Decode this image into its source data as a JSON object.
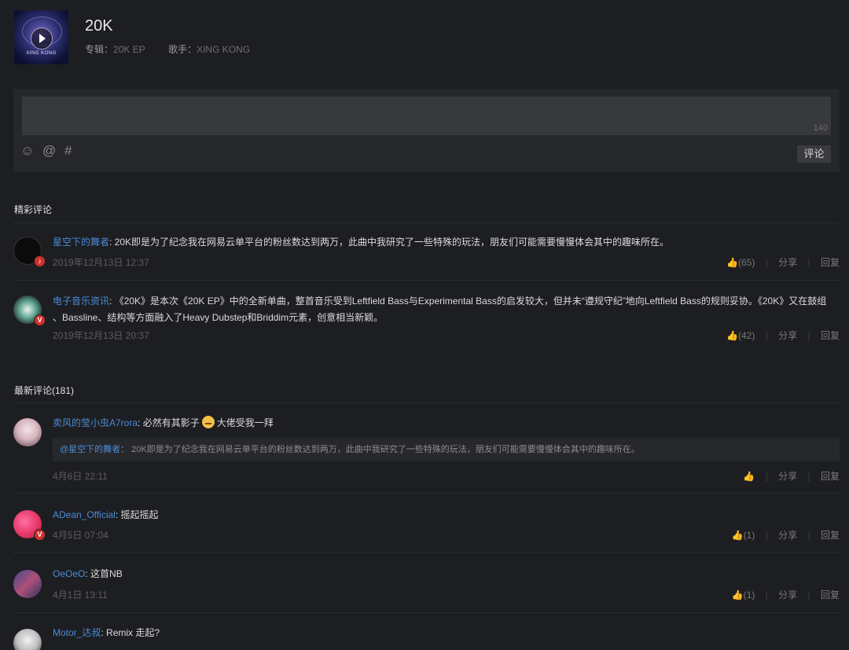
{
  "song": {
    "title": "20K",
    "cover_text": "XING KONG",
    "album_label": "专辑：",
    "album": "20K EP",
    "artist_label": "歌手：",
    "artist": "XING KONG"
  },
  "comment_box": {
    "placeholder": "",
    "char_count": "140",
    "submit_label": "评论",
    "icons": [
      "emoji-icon",
      "at-icon",
      "hashtag-icon"
    ]
  },
  "hot_section": {
    "title": "精彩评论"
  },
  "hot_comments": [
    {
      "user": "星空下的舞者",
      "text": "20K即是为了纪念我在网易云单平台的粉丝数达到两万，此曲中我研究了一些特殊的玩法，朋友们可能需要慢慢体会其中的趣味所在。",
      "time": "2019年12月13日 12:37",
      "likes": "(65)",
      "share": "分享",
      "reply": "回复"
    },
    {
      "user": "电子音乐资讯",
      "text_line1": "《20K》是本次《20K EP》中的全新单曲，整首音乐受到Leftfield Bass与Experimental Bass的启发较大，但并未“遵规守纪”地向Leftfield Bass的规则妥协。《20K》又在鼓组",
      "text_line2": "、Bassline、结构等方面融入了Heavy Dubstep和Briddim元素，创意相当新颖。",
      "time": "2019年12月13日 20:37",
      "likes": "(42)",
      "share": "分享",
      "reply": "回复"
    }
  ],
  "latest_section": {
    "title": "最新评论(181)"
  },
  "latest_comments": [
    {
      "user": "卖风的莹小虫A7rora",
      "text_before": "必然有其影子",
      "text_after": "大佬受我一拜",
      "quote_user": "@星空下的舞者",
      "quote_text": "20K即是为了纪念我在网易云单平台的粉丝数达到两万，此曲中我研究了一些特殊的玩法，朋友们可能需要慢慢体会其中的趣味所在。",
      "time": "4月6日 22:11",
      "likes": "",
      "share": "分享",
      "reply": "回复"
    },
    {
      "user": "ADean_Official",
      "text": "摇起摇起",
      "time": "4月5日 07:04",
      "likes": "(1)",
      "share": "分享",
      "reply": "回复"
    },
    {
      "user": "OeOeO",
      "text": "这首NB",
      "time": "4月1日 13:11",
      "likes": "(1)",
      "share": "分享",
      "reply": "回复"
    },
    {
      "user": "Motor_达叔",
      "text": "Remix 走起?"
    }
  ],
  "colors": {
    "background": "#1d1e22",
    "username": "#4a8bd6",
    "hot_like": "#d33a31"
  }
}
